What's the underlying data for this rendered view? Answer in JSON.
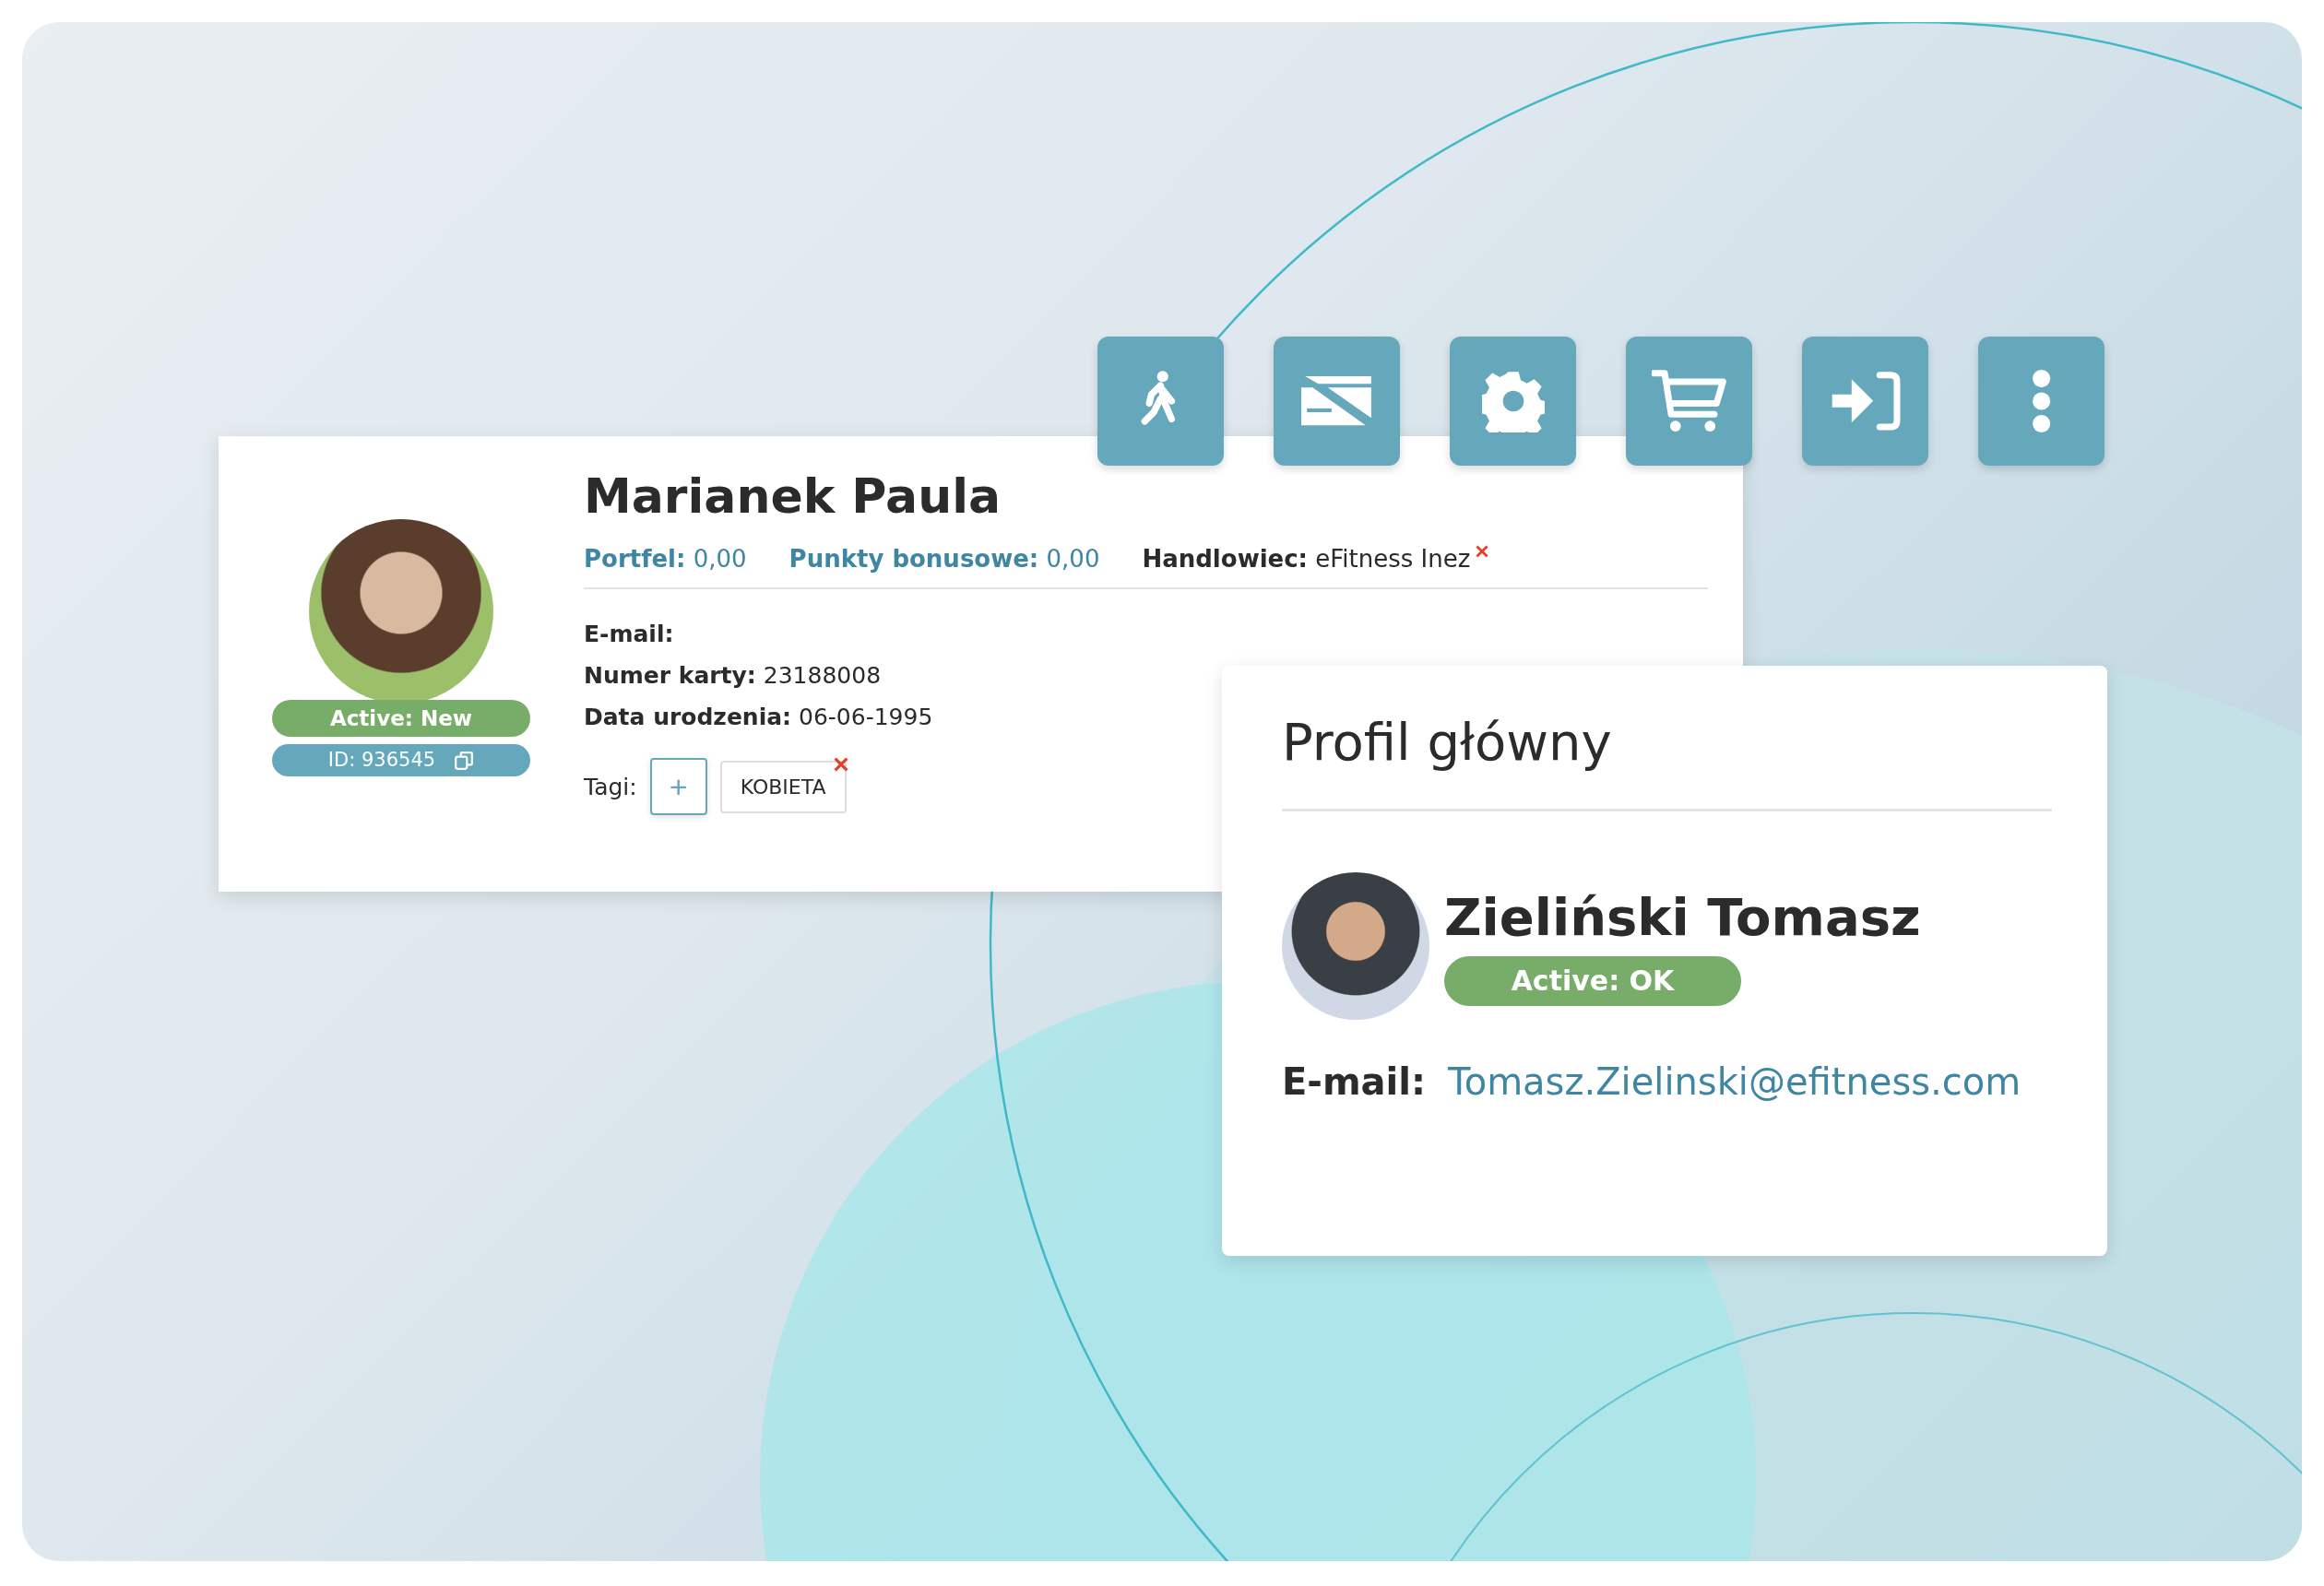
{
  "toolbar": [
    {
      "kind": "walk"
    },
    {
      "kind": "card"
    },
    {
      "kind": "settings"
    },
    {
      "kind": "cart"
    },
    {
      "kind": "login"
    },
    {
      "kind": "more"
    }
  ],
  "member": {
    "name": "Marianek Paula",
    "status": "Active: New",
    "id": "ID: 936545",
    "summary": [
      {
        "kind": "link",
        "label": "Portfel:",
        "value": "0,00"
      },
      {
        "kind": "link",
        "label": "Punkty bonusowe:",
        "value": "0,00"
      },
      {
        "kind": "assignee",
        "label": "Handlowiec:",
        "value": "eFitness Inez"
      }
    ],
    "fields": [
      {
        "label": "E-mail:"
      },
      {
        "label": "Numer karty:",
        "value": "23188008"
      },
      {
        "label": "Data urodzenia:",
        "value": "06-06-1995"
      }
    ],
    "tags_label": "Tagi:",
    "add_tag": "+",
    "tags": [
      {
        "label": "KOBIETA",
        "removable": true
      }
    ]
  },
  "main_profile": {
    "title": "Profil główny",
    "name": "Zieliński Tomasz",
    "status": "Active: OK",
    "email_label": "E-mail:",
    "email": "Tomasz.Zielinski@efitness.com"
  }
}
